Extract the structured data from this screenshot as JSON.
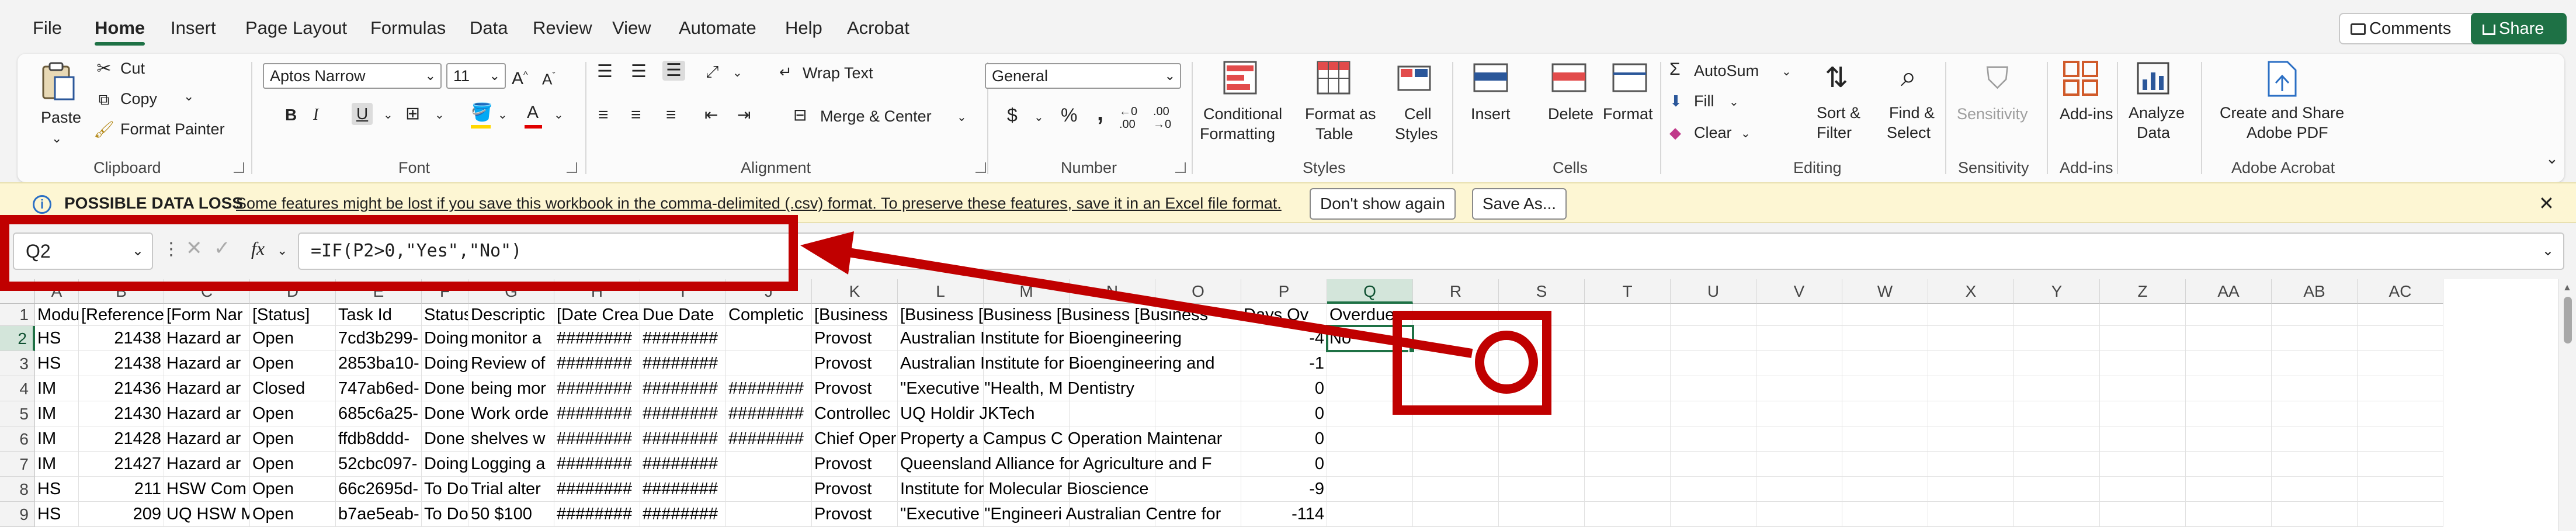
{
  "menu": {
    "file": "File",
    "home": "Home",
    "insert": "Insert",
    "page_layout": "Page Layout",
    "formulas": "Formulas",
    "data": "Data",
    "review": "Review",
    "view": "View",
    "automate": "Automate",
    "help": "Help",
    "acrobat": "Acrobat",
    "comments": "Comments",
    "share": "Share"
  },
  "ribbon": {
    "clipboard": {
      "label": "Clipboard",
      "paste": "Paste",
      "cut": "Cut",
      "copy": "Copy",
      "format_painter": "Format Painter"
    },
    "font": {
      "label": "Font",
      "name": "Aptos Narrow",
      "size": "11"
    },
    "alignment": {
      "label": "Alignment",
      "wrap_text": "Wrap Text",
      "merge_center": "Merge & Center"
    },
    "number": {
      "label": "Number",
      "format": "General"
    },
    "styles": {
      "label": "Styles",
      "conditional_1": "Conditional",
      "conditional_2": "Formatting",
      "format_table_1": "Format as",
      "format_table_2": "Table",
      "cell_styles_1": "Cell",
      "cell_styles_2": "Styles"
    },
    "cells": {
      "label": "Cells",
      "insert": "Insert",
      "delete": "Delete",
      "format": "Format"
    },
    "editing": {
      "label": "Editing",
      "autosum": "AutoSum",
      "fill": "Fill",
      "clear": "Clear",
      "sort_1": "Sort &",
      "sort_2": "Filter",
      "find_1": "Find &",
      "find_2": "Select"
    },
    "sensitivity": {
      "label": "Sensitivity",
      "button": "Sensitivity"
    },
    "addins": {
      "label": "Add-ins",
      "button": "Add-ins"
    },
    "analyze": {
      "line1": "Analyze",
      "line2": "Data"
    },
    "acrobat": {
      "label": "Adobe Acrobat",
      "line1": "Create and Share",
      "line2": "Adobe PDF"
    }
  },
  "message_bar": {
    "title": "POSSIBLE DATA LOSS",
    "text": "Some features might be lost if you save this workbook in the comma-delimited (.csv) format. To preserve these features, save it in an Excel file format.",
    "dont_show": "Don't show again",
    "save_as": "Save As..."
  },
  "formula_bar": {
    "name_box": "Q2",
    "fx": "fx",
    "formula": "=IF(P2>0,\"Yes\",\"No\")"
  },
  "grid": {
    "columns": [
      "A",
      "B",
      "C",
      "D",
      "E",
      "F",
      "G",
      "H",
      "I",
      "J",
      "K",
      "L",
      "M",
      "N",
      "O",
      "P",
      "Q",
      "R",
      "S",
      "T",
      "U",
      "V",
      "W",
      "X",
      "Y",
      "Z",
      "AA",
      "AB",
      "AC"
    ],
    "row_numbers": [
      "1",
      "2",
      "3",
      "4",
      "5",
      "6",
      "7",
      "8",
      "9"
    ],
    "header_row": [
      "Module Co",
      "[Reference",
      "[Form Nar",
      "[Status]",
      "Task Id",
      "Status",
      "Descriptic",
      "[Date Crea",
      "Due Date",
      "Completic",
      "[Business",
      "[Business [Business [Business [Business",
      "",
      "",
      "",
      "Days Ov",
      "Overdue"
    ],
    "rows": [
      [
        "HS",
        "21438",
        "Hazard ar",
        "Open",
        "7cd3b299-",
        "Doing",
        "monitor a",
        "########",
        "########",
        "",
        "Provost",
        "Australian Institute for Bioengineering",
        "",
        "",
        "",
        "-4",
        "No"
      ],
      [
        "HS",
        "21438",
        "Hazard ar",
        "Open",
        "2853ba10-",
        "Doing",
        "Review of",
        "########",
        "########",
        "",
        "Provost",
        "Australian Institute for Bioengineering and",
        "",
        "",
        "",
        "-1",
        ""
      ],
      [
        "IM",
        "21436",
        "Hazard ar",
        "Closed",
        "747ab6ed-",
        "Done",
        "being mor",
        "########",
        "########",
        "########",
        "Provost",
        "\"Executive \"Health, M Dentistry",
        "",
        "",
        "",
        "0",
        ""
      ],
      [
        "IM",
        "21430",
        "Hazard ar",
        "Open",
        "685c6a25-",
        "Done",
        "Work orde",
        "########",
        "########",
        "########",
        "Controllec",
        "UQ Holdir JKTech",
        "",
        "",
        "",
        "0",
        ""
      ],
      [
        "IM",
        "21428",
        "Hazard ar",
        "Open",
        "ffdb8ddd-",
        "Done",
        "shelves w",
        "########",
        "########",
        "########",
        "Chief Oper",
        "Property a Campus C Operation Maintenar",
        "",
        "",
        "",
        "0",
        ""
      ],
      [
        "IM",
        "21427",
        "Hazard ar",
        "Open",
        "52cbc097-",
        "Doing",
        "Logging a",
        "########",
        "########",
        "",
        "Provost",
        "Queensland Alliance for Agriculture and F",
        "",
        "",
        "",
        "0",
        ""
      ],
      [
        "HS",
        "211",
        "HSW Com",
        "Open",
        "66c2695d-",
        "To Do",
        "Trial alter",
        "########",
        "########",
        "",
        "Provost",
        "Institute for Molecular Bioscience",
        "",
        "",
        "",
        "-9",
        ""
      ],
      [
        "HS",
        "209",
        "UQ HSW M",
        "Open",
        "b7ae5eab-",
        "To Do",
        "50 $100",
        "########",
        "########",
        "",
        "Provost",
        "\"Executive \"Engineeri Australian Centre for",
        "",
        "",
        "",
        "-114",
        ""
      ]
    ]
  }
}
